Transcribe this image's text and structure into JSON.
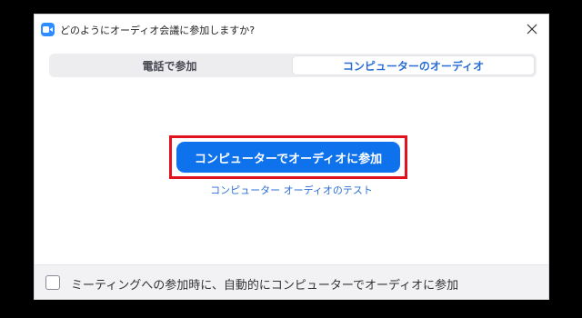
{
  "dialog": {
    "title": "どのようにオーディオ会議に参加しますか?",
    "app_icon": "zoom-camera-icon",
    "close_icon": "close-icon"
  },
  "tabs": [
    {
      "label": "電話で参加",
      "active": false
    },
    {
      "label": "コンピューターのオーディオ",
      "active": true
    }
  ],
  "main": {
    "join_button_label": "コンピューターでオーディオに参加",
    "test_link_label": "コンピューター オーディオのテスト"
  },
  "footer": {
    "checkbox_checked": false,
    "checkbox_label": "ミーティングへの参加時に、自動的にコンピューターでオーディオに参加"
  },
  "colors": {
    "accent": "#0e72ed",
    "link": "#2b6fd6",
    "highlight": "#e0121e",
    "zoom_blue": "#2d8cff"
  }
}
